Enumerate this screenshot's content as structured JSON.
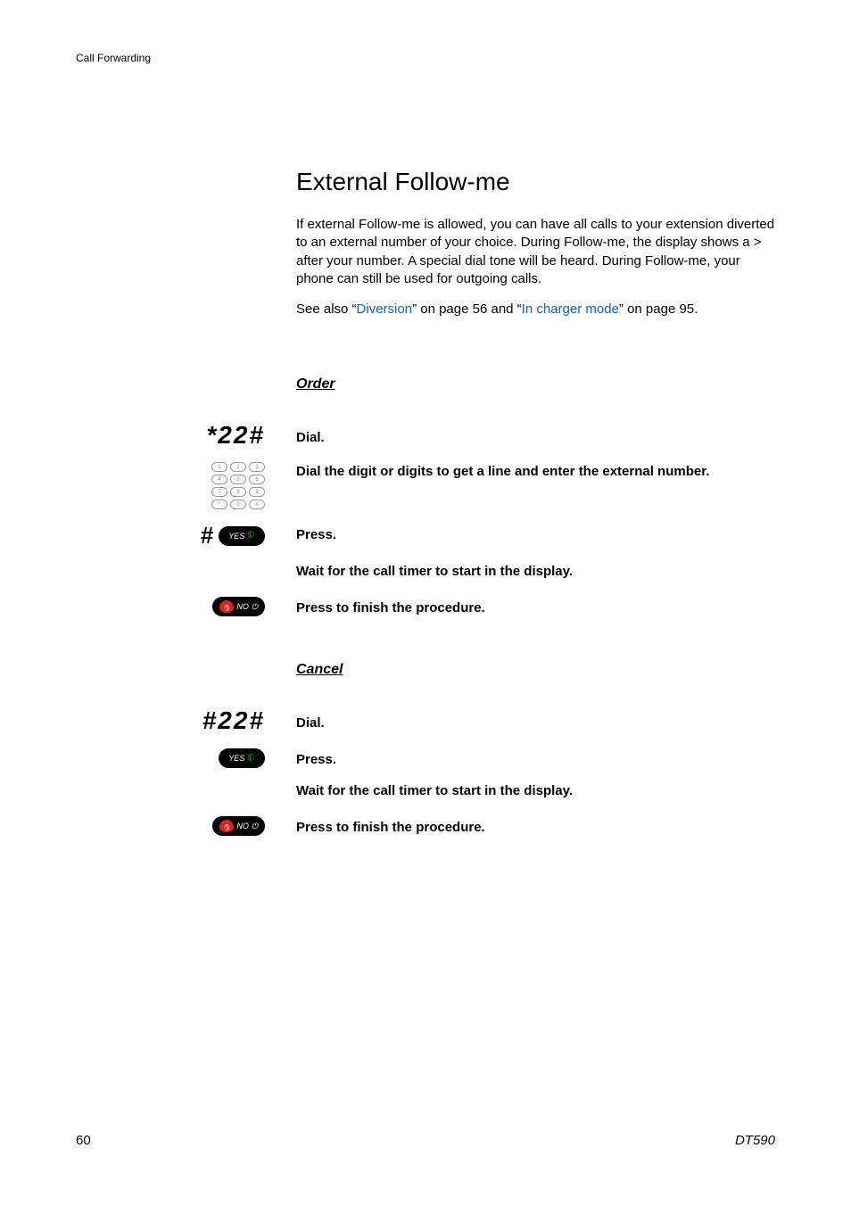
{
  "header": "Call Forwarding",
  "title": "External Follow-me",
  "intro": "If external Follow-me is allowed, you can have all calls to your extension diverted to an external number of your choice. During Follow-me, the display shows a > after your number. A special dial tone will be heard. During Follow-me, your phone can still be used for outgoing calls.",
  "seealso_prefix": "See also “",
  "seealso_link1": "Diversion",
  "seealso_mid1": "” on page 56 and “",
  "seealso_link2": "In charger mode",
  "seealso_mid2": "” on page 95.",
  "order": {
    "heading": "Order",
    "code": "*22#",
    "step1": "Dial.",
    "step2": "Dial the digit or digits to get a line and enter the external number.",
    "step3": "Press.",
    "step4": "Wait for the call timer to start in the display.",
    "step5": "Press to finish the procedure."
  },
  "cancel": {
    "heading": "Cancel",
    "code": "#22#",
    "step1": "Dial.",
    "step2": "Press.",
    "step3": "Wait for the call timer to start in the display.",
    "step4": "Press to finish the procedure."
  },
  "labels": {
    "yes": "YES",
    "no": "NO",
    "hash": "#"
  },
  "footer": {
    "page": "60",
    "model": "DT590"
  },
  "keypad": [
    "1",
    "2",
    "3",
    "4",
    "5",
    "6",
    "7",
    "8",
    "9",
    "*",
    "0",
    "#"
  ]
}
